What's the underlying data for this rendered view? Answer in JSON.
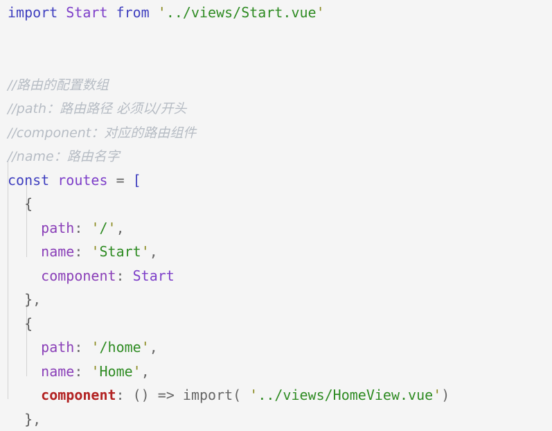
{
  "editor": {
    "language": "javascript",
    "background_color": "#f5f5f5",
    "font_size_px": 20,
    "line_height_px": 34.5,
    "colors": {
      "keyword": "#3f3fbf",
      "identifier": "#7d3ec9",
      "property_key": "#8a3fb8",
      "property_key_highlight": "#b22222",
      "string": "#2e8b22",
      "quote": "#8a8a1f",
      "punctuation": "#666666",
      "brace": "#5a5a5a",
      "comment": "#b6bcc4",
      "indent_guide": "#d2d2d2"
    }
  },
  "code": {
    "line_1": {
      "kw_import": "import",
      "ident_start": "Start",
      "kw_from": "from",
      "quote_open": "'",
      "string_path": "../views/Start.vue",
      "quote_close": "'"
    },
    "comments": {
      "line_4": "//路由的配置数组",
      "line_5": "//path：路由路径 必须以/开头",
      "line_6": "//component：对应的路由组件",
      "line_7": "//name：路由名字"
    },
    "line_8": {
      "kw_const": "const",
      "ident_routes": "routes",
      "op_assign": "=",
      "bracket_open": "["
    },
    "object_1": {
      "brace_open": "{",
      "key_path": "path",
      "colon": ":",
      "quote_open": "'",
      "value_path": "/",
      "quote_close": "'",
      "comma": ",",
      "key_name": "name",
      "value_name": "Start",
      "key_component": "component",
      "value_component": "Start",
      "brace_close": "}",
      "brace_close_comma": ","
    },
    "object_2": {
      "brace_open": "{",
      "key_path": "path",
      "colon": ":",
      "quote_open": "'",
      "value_path": "/home",
      "quote_close": "'",
      "comma": ",",
      "key_name": "name",
      "value_name": "Home",
      "key_component": "component",
      "arrow_fn_params": "()",
      "arrow": "=>",
      "fn_import": "import(",
      "quote_open_2": "'",
      "value_component_path": "../views/HomeView.vue",
      "quote_close_2": "'",
      "paren_close": ")",
      "brace_close": "}",
      "brace_close_comma": ","
    }
  }
}
